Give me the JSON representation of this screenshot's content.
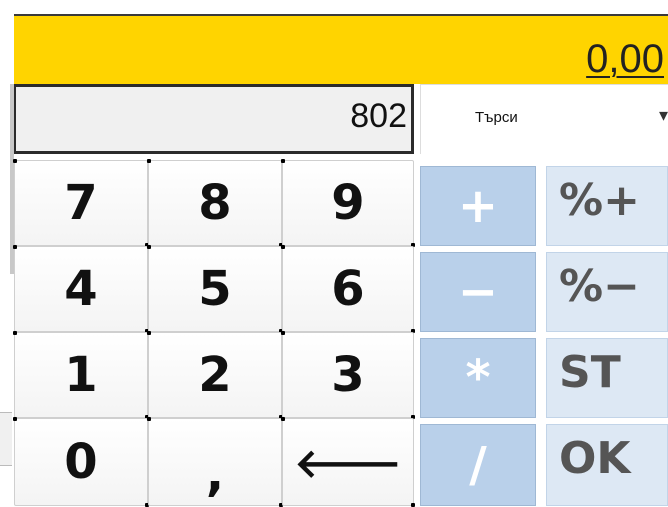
{
  "display": {
    "amount": "0,00",
    "input": "802"
  },
  "search": {
    "label": "Търси",
    "caret": "▾"
  },
  "keypad": {
    "rows": [
      [
        "7",
        "8",
        "9"
      ],
      [
        "4",
        "5",
        "6"
      ],
      [
        "1",
        "2",
        "3"
      ],
      [
        "0",
        ",",
        "🡐"
      ]
    ]
  },
  "operators": [
    "+",
    "−",
    "*",
    "/"
  ],
  "functions": [
    "%+",
    "%−",
    "ST",
    "OK"
  ],
  "colors": {
    "amount_bar": "#ffd400",
    "operator_key": "#b9d0ea",
    "function_key": "#dde8f4"
  }
}
